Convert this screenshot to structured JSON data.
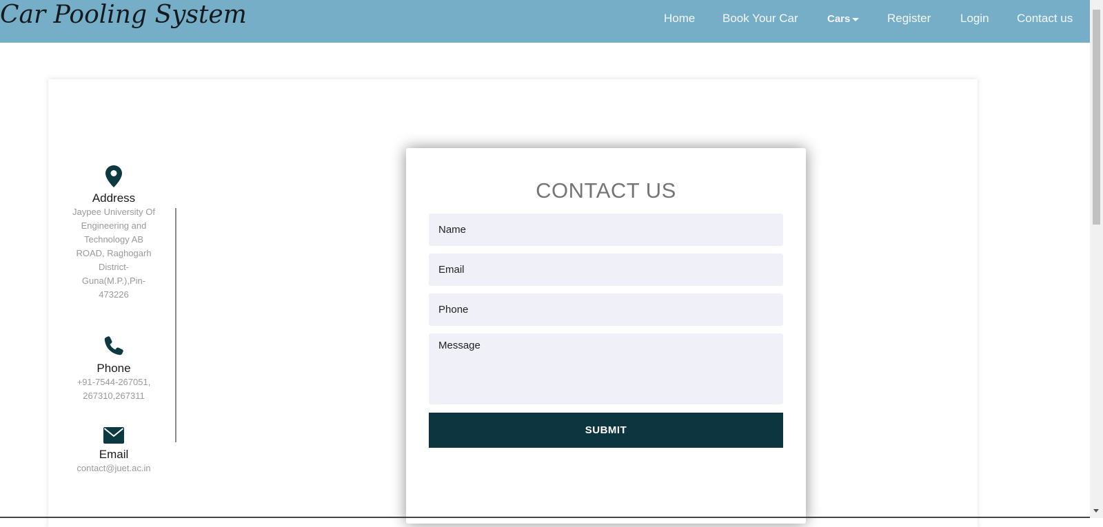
{
  "header": {
    "brand": "Car Pooling System",
    "nav": {
      "home": "Home",
      "book": "Book Your Car",
      "cars": "Cars",
      "register": "Register",
      "login": "Login",
      "contact": "Contact us"
    }
  },
  "info": {
    "address_title": "Address",
    "address_text": "Jaypee University Of Engineering and Technology AB ROAD, Raghogarh District-Guna(M.P.),Pin-473226",
    "phone_title": "Phone",
    "phone_text": "+91-7544-267051, 267310,267311",
    "email_title": "Email",
    "email_text": "contact@juet.ac.in"
  },
  "form": {
    "title": "CONTACT US",
    "name_placeholder": "Name",
    "email_placeholder": "Email",
    "phone_placeholder": "Phone",
    "message_placeholder": "Message",
    "submit_label": "SUBMIT"
  },
  "colors": {
    "navbar": "#77aec7",
    "button": "#0d3540",
    "icon": "#0d3a40",
    "field_bg": "#eff0f8"
  },
  "icons": {
    "address": "map-marker-icon",
    "phone": "phone-icon",
    "email": "envelope-icon"
  }
}
